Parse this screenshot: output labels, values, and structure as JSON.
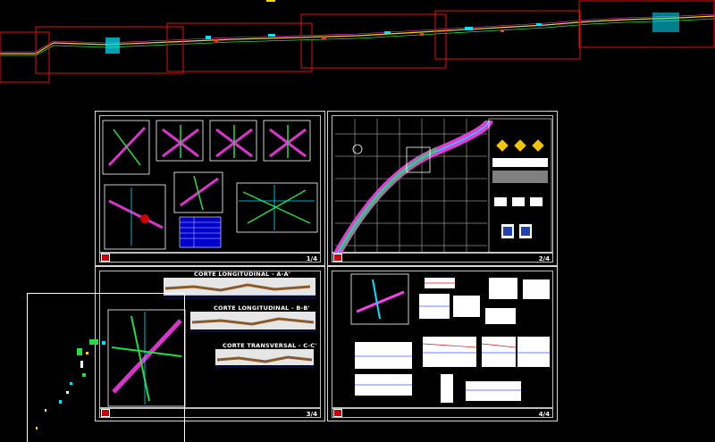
{
  "sheets": [
    {
      "id": "sheet-1",
      "number": "1/4"
    },
    {
      "id": "sheet-2",
      "number": "2/4"
    },
    {
      "id": "sheet-3",
      "number": "3/4"
    },
    {
      "id": "sheet-4",
      "number": "4/4"
    }
  ],
  "sections": {
    "corte_a": "CORTE LONGITUDINAL - A-A'",
    "corte_b": "CORTE LONGITUDINAL - B-B'",
    "corte_c": "CORTE TRANSVERSAL - C-C'"
  },
  "colors": {
    "background": "#000000",
    "sheet_border": "#d8d8d8",
    "viewport_frame": "#e11111",
    "road_magenta": "#ff3df0",
    "road_green": "#22dd44",
    "road_cyan": "#00e5ff",
    "sign_yellow": "#f5c400"
  }
}
